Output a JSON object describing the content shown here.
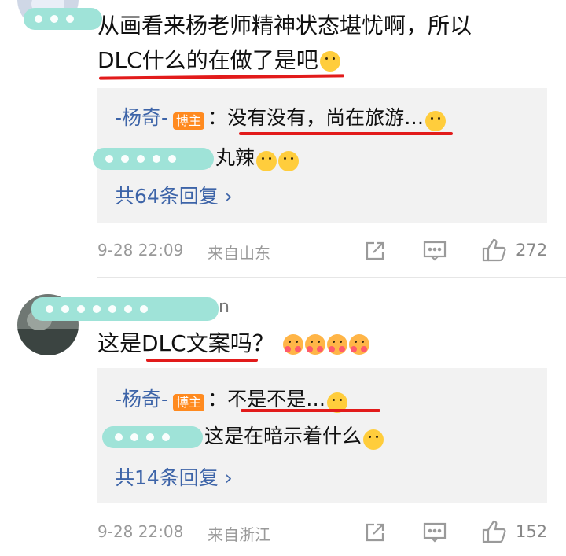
{
  "comments": [
    {
      "text_line1": "从画看来杨老师精神状态堪忧啊，所以",
      "text_line2": "DLC什么的在做了是吧",
      "reply": {
        "author": "-杨奇-",
        "badge": "博主",
        "text": "：没有没有，尚在旅游…",
        "sub_reply_visible": "丸辣",
        "more": "共64条回复 ›"
      },
      "timestamp": "9-28 22:09",
      "location": "来自山东",
      "likes": "272"
    },
    {
      "username_tail": "n",
      "text": "这是DLC文案吗？",
      "reply": {
        "author": "-杨奇-",
        "badge": "博主",
        "text": "：不是不是…",
        "sub_reply_visible": "这是在暗示着什么",
        "more": "共14条回复 ›"
      },
      "timestamp": "9-28 22:08",
      "location": "来自浙江",
      "likes": "152"
    }
  ],
  "icons": [
    "share-icon",
    "comment-icon",
    "like-icon",
    "emoji-icon"
  ],
  "colors": {
    "link": "#3d64a8",
    "badge": "#ff8a1f",
    "underline": "#e21b1b",
    "redaction": "#9fe3d8"
  }
}
